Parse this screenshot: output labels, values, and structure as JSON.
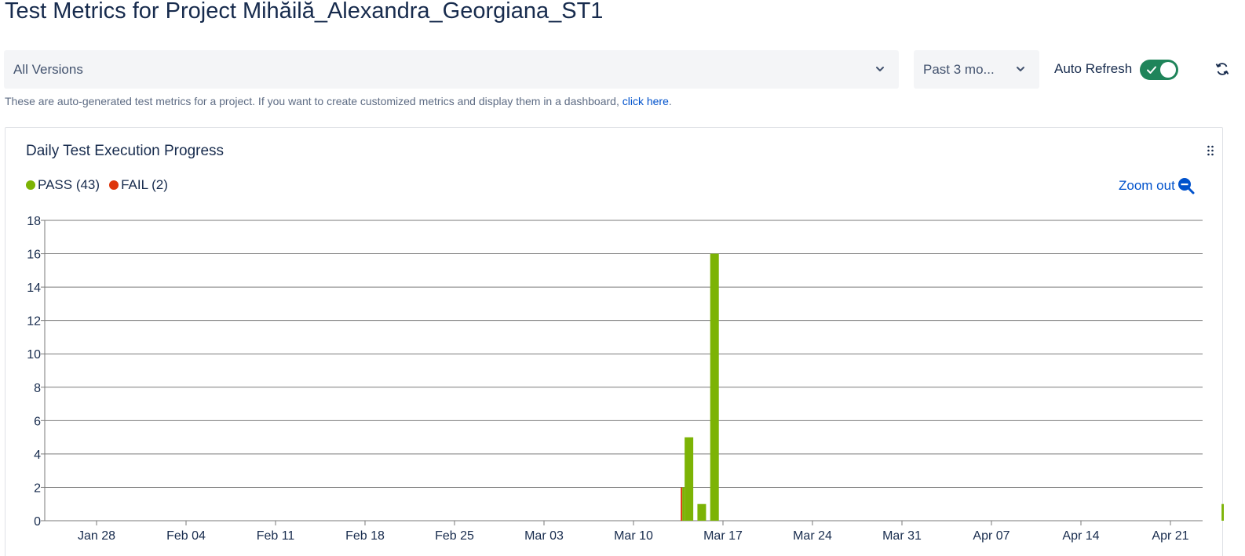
{
  "page": {
    "title": "Test Metrics for Project Mihăilă_Alexandra_Georgiana_ST1"
  },
  "filters": {
    "versions_value": "All Versions",
    "period_value": "Past 3 mo...",
    "auto_refresh_label": "Auto Refresh",
    "auto_refresh_on": true
  },
  "info": {
    "text": "These are auto-generated test metrics for a project. If you want to create customized metrics and display them in a dashboard, ",
    "link_text": "click here",
    "trailing": "."
  },
  "card": {
    "title": "Daily Test Execution Progress",
    "zoom_out_label": "Zoom out"
  },
  "legend": [
    {
      "label": "PASS (43)",
      "color": "#7cb305"
    },
    {
      "label": "FAIL (2)",
      "color": "#de350b"
    }
  ],
  "colors": {
    "pass": "#7cb305",
    "fail": "#de350b",
    "toggle_on": "#1f845a",
    "link": "#0052cc"
  },
  "icons": {
    "versions_dropdown": "chevron-down-icon",
    "period_dropdown": "chevron-down-icon",
    "toggle_check": "check-icon",
    "refresh": "refresh-icon",
    "drag": "drag-handle-icon",
    "zoom": "zoom-out-icon"
  },
  "chart_data": {
    "type": "bar",
    "title": "Daily Test Execution Progress",
    "x_ticks": [
      "Jan 28",
      "Feb 04",
      "Feb 11",
      "Feb 18",
      "Feb 25",
      "Mar 03",
      "Mar 10",
      "Mar 17",
      "Mar 24",
      "Mar 31",
      "Apr 07",
      "Apr 14",
      "Apr 21"
    ],
    "ylim": [
      0,
      18
    ],
    "y_ticks": [
      0,
      2,
      4,
      6,
      8,
      10,
      12,
      14,
      16,
      18
    ],
    "grid": true,
    "stacked": true,
    "series": [
      {
        "name": "PASS",
        "color": "#7cb305",
        "points": [
          {
            "date": "2024-03-14",
            "value": 2
          },
          {
            "date": "2024-03-14",
            "value": 5
          },
          {
            "date": "2024-03-15",
            "value": 1
          },
          {
            "date": "2024-03-16",
            "value": 16
          },
          {
            "date": "2024-04-25",
            "value": 1
          }
        ]
      },
      {
        "name": "FAIL",
        "color": "#de350b",
        "points": [
          {
            "date": "2024-03-14",
            "value": 1
          }
        ]
      }
    ]
  }
}
